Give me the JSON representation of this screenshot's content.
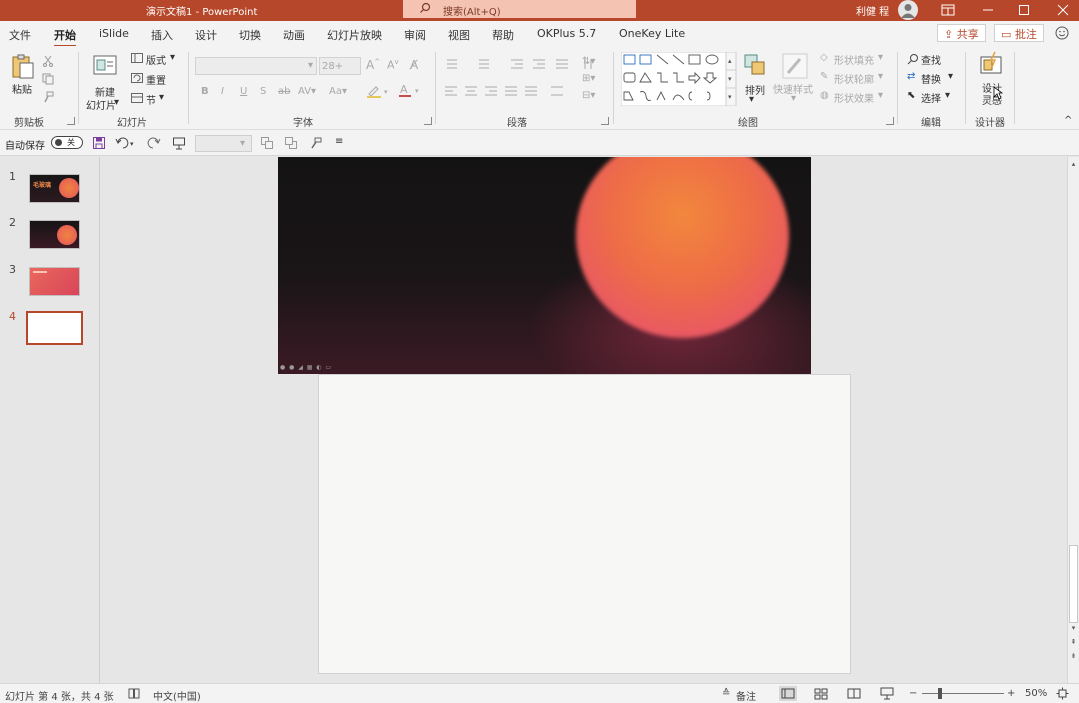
{
  "titlebar": {
    "title": "演示文稿1  -  PowerPoint",
    "search_placeholder": "搜索(Alt+Q)",
    "user": "利健 程"
  },
  "tabs": [
    {
      "label": "文件"
    },
    {
      "label": "开始",
      "active": true
    },
    {
      "label": "iSlide"
    },
    {
      "label": "插入"
    },
    {
      "label": "设计"
    },
    {
      "label": "切换"
    },
    {
      "label": "动画"
    },
    {
      "label": "幻灯片放映"
    },
    {
      "label": "审阅"
    },
    {
      "label": "视图"
    },
    {
      "label": "帮助"
    },
    {
      "label": "OKPlus 5.7"
    },
    {
      "label": "OneKey Lite"
    }
  ],
  "share": {
    "share_label": "共享",
    "comment_label": "批注"
  },
  "ribbon": {
    "clipboard": {
      "paste": "粘贴",
      "group": "剪贴板"
    },
    "slides": {
      "new_line1": "新建",
      "new_line2": "幻灯片",
      "layout": "版式",
      "reset": "重置",
      "section": "节",
      "group": "幻灯片"
    },
    "font": {
      "size": "28+",
      "group": "字体"
    },
    "paragraph": {
      "group": "段落"
    },
    "drawing": {
      "arrange": "排列",
      "quick_styles": "快速样式",
      "fill": "形状填充",
      "outline": "形状轮廓",
      "effects": "形状效果",
      "group": "绘图"
    },
    "editing": {
      "find": "查找",
      "replace": "替换",
      "select": "选择",
      "group": "编辑"
    },
    "designer": {
      "line1": "设计",
      "line2": "灵感",
      "group": "设计器"
    }
  },
  "qat": {
    "autosave": "自动保存",
    "toggle": "关"
  },
  "slides": [
    {
      "num": "1",
      "title": "毛玻璃"
    },
    {
      "num": "2"
    },
    {
      "num": "3"
    },
    {
      "num": "4",
      "active": true
    }
  ],
  "status": {
    "slide_info": "幻灯片 第 4 张，共 4 张",
    "language": "中文(中国)",
    "notes": "备注",
    "zoom": "50%",
    "zoom_minus": "−",
    "zoom_plus": "+"
  },
  "colors": {
    "accent": "#b7472a",
    "search_bg": "#f4c3b2",
    "ribbon_bg": "#f3f3f3"
  }
}
